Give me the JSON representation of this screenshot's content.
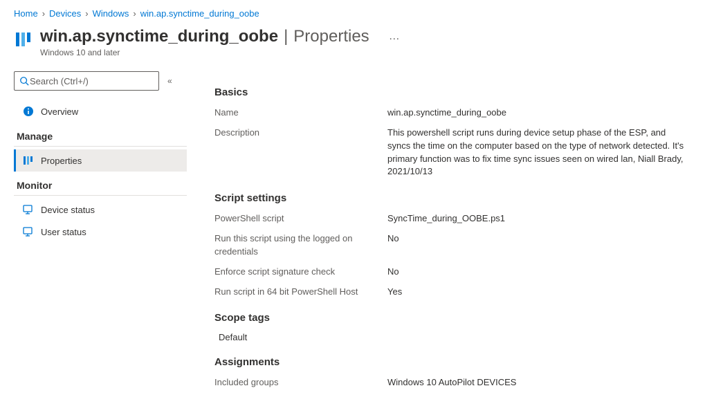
{
  "breadcrumb": {
    "items": [
      "Home",
      "Devices",
      "Windows",
      "win.ap.synctime_during_oobe"
    ]
  },
  "header": {
    "title": "win.ap.synctime_during_oobe",
    "section": "Properties",
    "meta": "Windows 10 and later"
  },
  "search": {
    "placeholder": "Search (Ctrl+/)"
  },
  "sidebar": {
    "overview": "Overview",
    "sections": {
      "manage": "Manage",
      "monitor": "Monitor"
    },
    "items": {
      "properties": "Properties",
      "device_status": "Device status",
      "user_status": "User status"
    }
  },
  "content": {
    "sections": {
      "basics": "Basics",
      "script_settings": "Script settings",
      "scope_tags": "Scope tags",
      "assignments": "Assignments"
    },
    "basics": {
      "name_label": "Name",
      "name_value": "win.ap.synctime_during_oobe",
      "description_label": "Description",
      "description_value": "This powershell script runs during device setup phase of the ESP, and syncs the time on the computer based on the type of network detected. It's primary function was to fix time sync issues seen on wired lan, Niall Brady, 2021/10/13"
    },
    "script_settings": {
      "script_label": "PowerShell script",
      "script_value": "SyncTime_during_OOBE.ps1",
      "creds_label": "Run this script using the logged on credentials",
      "creds_value": "No",
      "enforce_label": "Enforce script signature check",
      "enforce_value": "No",
      "run64_label": "Run script in 64 bit PowerShell Host",
      "run64_value": "Yes"
    },
    "scope_tags": {
      "value": "Default"
    },
    "assignments": {
      "included_label": "Included groups",
      "included_value": "Windows 10 AutoPilot DEVICES"
    }
  }
}
